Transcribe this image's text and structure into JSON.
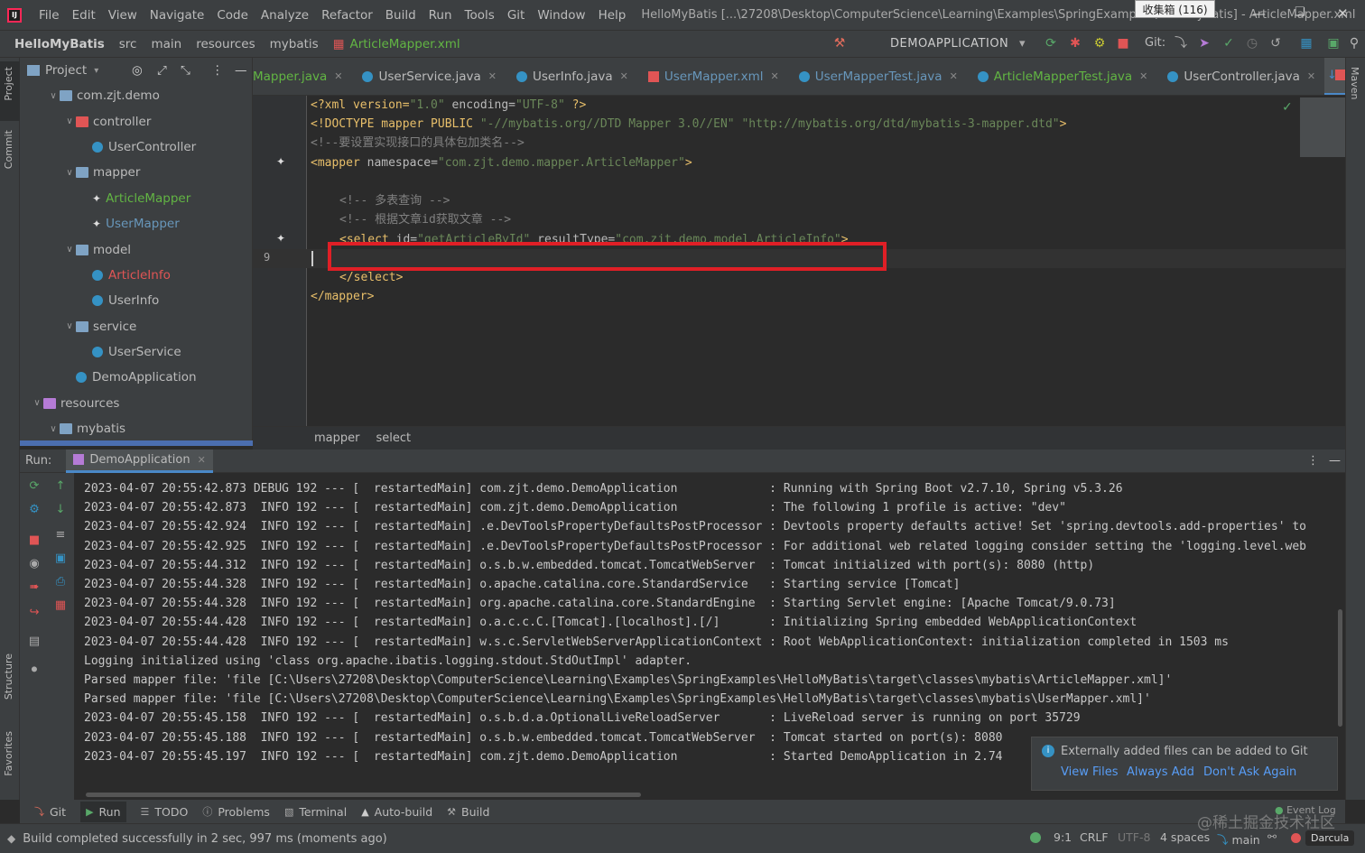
{
  "title_bar": {
    "menu": [
      "File",
      "Edit",
      "View",
      "Navigate",
      "Code",
      "Analyze",
      "Refactor",
      "Build",
      "Run",
      "Tools",
      "Git",
      "Window",
      "Help"
    ],
    "window_title": "HelloMyBatis [...\\27208\\Desktop\\ComputerScience\\Learning\\Examples\\SpringExamples\\HelloMyBatis] - ArticleMapper.xml",
    "tooltip": "收集箱 (116)"
  },
  "nav_bar": {
    "crumbs": [
      "HelloMyBatis",
      "src",
      "main",
      "resources",
      "mybatis",
      "ArticleMapper.xml"
    ],
    "run_config": "DEMOAPPLICATION",
    "git_label": "Git:"
  },
  "side_tabs": {
    "project": "Project",
    "commit": "Commit",
    "structure": "Structure",
    "favorites": "Favorites",
    "maven": "Maven"
  },
  "project_panel": {
    "title": "Project",
    "tree": [
      {
        "label": "com.zjt.demo",
        "level": 2,
        "type": "package",
        "open": true
      },
      {
        "label": "controller",
        "level": 3,
        "type": "package-web",
        "open": true
      },
      {
        "label": "UserController",
        "level": 4,
        "type": "java"
      },
      {
        "label": "mapper",
        "level": 3,
        "type": "package",
        "open": true
      },
      {
        "label": "ArticleMapper",
        "level": 4,
        "type": "mybatis",
        "color": "#62b543"
      },
      {
        "label": "UserMapper",
        "level": 4,
        "type": "mybatis",
        "color": "#6897bb"
      },
      {
        "label": "model",
        "level": 3,
        "type": "package",
        "open": true
      },
      {
        "label": "ArticleInfo",
        "level": 4,
        "type": "java",
        "color": "#e05555"
      },
      {
        "label": "UserInfo",
        "level": 4,
        "type": "java"
      },
      {
        "label": "service",
        "level": 3,
        "type": "package",
        "open": true
      },
      {
        "label": "UserService",
        "level": 4,
        "type": "java"
      },
      {
        "label": "DemoApplication",
        "level": 3,
        "type": "java"
      },
      {
        "label": "resources",
        "level": 1,
        "type": "resources",
        "open": true
      },
      {
        "label": "mybatis",
        "level": 2,
        "type": "folder",
        "open": true
      }
    ]
  },
  "editor_tabs": [
    {
      "label": "Mapper.java",
      "color": "#62b543",
      "icon": "java"
    },
    {
      "label": "UserService.java",
      "color": "#bbbbbb",
      "icon": "java"
    },
    {
      "label": "UserInfo.java",
      "color": "#bbbbbb",
      "icon": "java"
    },
    {
      "label": "UserMapper.xml",
      "color": "#6897bb",
      "icon": "xml"
    },
    {
      "label": "UserMapperTest.java",
      "color": "#6897bb",
      "icon": "java"
    },
    {
      "label": "ArticleMapperTest.java",
      "color": "#62b543",
      "icon": "java"
    },
    {
      "label": "UserController.java",
      "color": "#bbbbbb",
      "icon": "java"
    },
    {
      "label": "ArticleMapper.xml",
      "color": "#62b543",
      "icon": "xml",
      "active": true
    }
  ],
  "code": {
    "l1": [
      "<?xml version=",
      "\"1.0\"",
      " encoding=",
      "\"UTF-8\"",
      " ?>"
    ],
    "l2": [
      "<!DOCTYPE mapper PUBLIC ",
      "\"-//mybatis.org//DTD Mapper 3.0//EN\"",
      " ",
      "\"http://mybatis.org/dtd/mybatis-3-mapper.dtd\"",
      ">"
    ],
    "l3": "<!--要设置实现接口的具体包加类名-->",
    "l4": [
      "<mapper",
      " namespace=",
      "\"com.zjt.demo.mapper.ArticleMapper\"",
      ">"
    ],
    "l6": "<!-- 多表查询 -->",
    "l7": "<!-- 根据文章id获取文章 -->",
    "l8": [
      "<select",
      " id=",
      "\"getArticleById\"",
      " resultType=",
      "\"com.zjt.demo.model.ArticleInfo\"",
      ">"
    ],
    "l9_number": "9",
    "l10": "</select>",
    "l11": "</mapper>"
  },
  "editor_breadcrumb": [
    "mapper",
    "select"
  ],
  "run_panel": {
    "label": "Run:",
    "tab": "DemoApplication",
    "logs": [
      "2023-04-07 20:55:42.873 DEBUG 192 --- [  restartedMain] com.zjt.demo.DemoApplication             : Running with Spring Boot v2.7.10, Spring v5.3.26",
      "2023-04-07 20:55:42.873  INFO 192 --- [  restartedMain] com.zjt.demo.DemoApplication             : The following 1 profile is active: \"dev\"",
      "2023-04-07 20:55:42.924  INFO 192 --- [  restartedMain] .e.DevToolsPropertyDefaultsPostProcessor : Devtools property defaults active! Set 'spring.devtools.add-properties' to",
      "2023-04-07 20:55:42.925  INFO 192 --- [  restartedMain] .e.DevToolsPropertyDefaultsPostProcessor : For additional web related logging consider setting the 'logging.level.web",
      "2023-04-07 20:55:44.312  INFO 192 --- [  restartedMain] o.s.b.w.embedded.tomcat.TomcatWebServer  : Tomcat initialized with port(s): 8080 (http)",
      "2023-04-07 20:55:44.328  INFO 192 --- [  restartedMain] o.apache.catalina.core.StandardService   : Starting service [Tomcat]",
      "2023-04-07 20:55:44.328  INFO 192 --- [  restartedMain] org.apache.catalina.core.StandardEngine  : Starting Servlet engine: [Apache Tomcat/9.0.73]",
      "2023-04-07 20:55:44.428  INFO 192 --- [  restartedMain] o.a.c.c.C.[Tomcat].[localhost].[/]       : Initializing Spring embedded WebApplicationContext",
      "2023-04-07 20:55:44.428  INFO 192 --- [  restartedMain] w.s.c.ServletWebServerApplicationContext : Root WebApplicationContext: initialization completed in 1503 ms",
      "Logging initialized using 'class org.apache.ibatis.logging.stdout.StdOutImpl' adapter.",
      "Parsed mapper file: 'file [C:\\Users\\27208\\Desktop\\ComputerScience\\Learning\\Examples\\SpringExamples\\HelloMyBatis\\target\\classes\\mybatis\\ArticleMapper.xml]'",
      "Parsed mapper file: 'file [C:\\Users\\27208\\Desktop\\ComputerScience\\Learning\\Examples\\SpringExamples\\HelloMyBatis\\target\\classes\\mybatis\\UserMapper.xml]'",
      "2023-04-07 20:55:45.158  INFO 192 --- [  restartedMain] o.s.b.d.a.OptionalLiveReloadServer       : LiveReload server is running on port 35729",
      "2023-04-07 20:55:45.188  INFO 192 --- [  restartedMain] o.s.b.w.embedded.tomcat.TomcatWebServer  : Tomcat started on port(s): 8080",
      "2023-04-07 20:55:45.197  INFO 192 --- [  restartedMain] com.zjt.demo.DemoApplication             : Started DemoApplication in 2.74"
    ]
  },
  "notification": {
    "text": "Externally added files can be added to Git",
    "actions": [
      "View Files",
      "Always Add",
      "Don't Ask Again"
    ]
  },
  "bottom_tabs": [
    "Git",
    "Run",
    "TODO",
    "Problems",
    "Terminal",
    "Auto-build",
    "Build"
  ],
  "status_bar": {
    "message": "Build completed successfully in 2 sec, 997 ms (moments ago)",
    "position": "9:1",
    "line_sep": "CRLF",
    "encoding": "UTF-8",
    "indent": "4 spaces",
    "branch": "main",
    "theme": "Darcula",
    "event_log": "Event Log",
    "watermark": "@稀土掘金技术社区"
  }
}
